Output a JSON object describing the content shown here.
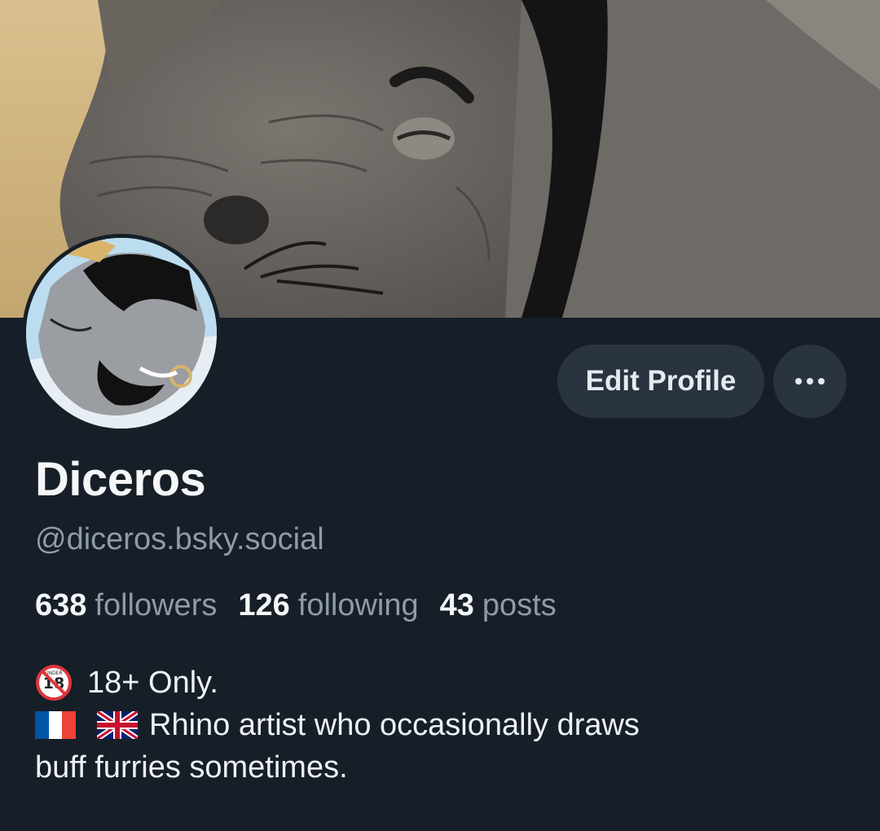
{
  "profile": {
    "display_name": "Diceros",
    "handle": "@diceros.bsky.social",
    "edit_button_label": "Edit Profile",
    "more_button_label": "•••"
  },
  "stats": {
    "followers_count": "638",
    "followers_label": "followers",
    "following_count": "126",
    "following_label": "following",
    "posts_count": "43",
    "posts_label": "posts"
  },
  "bio": {
    "line1_text": "18+ Only.",
    "line1_icon": "under-18-prohibited-icon",
    "line2_flags": [
      "france-flag-icon",
      "uk-flag-icon"
    ],
    "line2_text": "Rhino artist who occasionally draws",
    "line3_text": "buff furries sometimes."
  },
  "colors": {
    "background": "#161e27",
    "button_bg": "#2a3441",
    "secondary_text": "#8f9ba8",
    "primary_text": "#f4f6f8"
  }
}
